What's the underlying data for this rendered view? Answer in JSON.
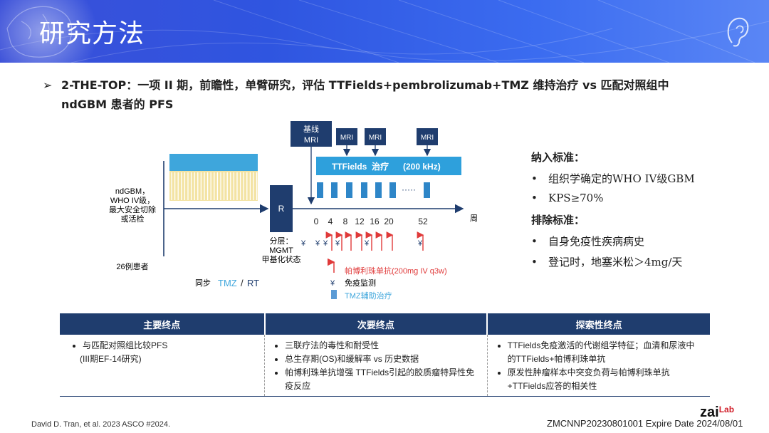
{
  "header": {
    "title": "研究方法"
  },
  "bullet": {
    "arrow": "➢",
    "line1": "2-THE-TOP：一项 II 期，前瞻性，单臂研究，评估 TTFields+pembrolizumab+TMZ 维持治疗 vs 匹配对照组中",
    "line2": "ndGBM 患者的 PFS"
  },
  "schema": {
    "patient_label": [
      "ndGBM，",
      "WHO IV级，",
      "最大安全切除",
      "或活检"
    ],
    "patient_count": "26例患者",
    "sync_label": "同步",
    "sync_tmz": "TMZ",
    "sync_sep": "/",
    "sync_rt": "RT",
    "r_label": "R",
    "strat": [
      "分层：",
      "MGMT",
      "甲基化状态"
    ],
    "baseline_mri": [
      "基线",
      "MRI"
    ],
    "mri": "MRI",
    "ttfields_bar": "TTFields  治疗      (200 kHz)",
    "dots": "·····",
    "weeks": [
      "0",
      "4",
      "8",
      "12",
      "16",
      "20",
      "52"
    ],
    "week_unit": "周",
    "yen": "¥",
    "legend_pembro": "帕博利珠单抗(200mg IV q3w)",
    "legend_immune": "免疫监测",
    "legend_tmz": "TMZ辅助治疗"
  },
  "criteria": {
    "inclusion_title": "纳入标准：",
    "inclusion": [
      "组织学确定的WHO IV级GBM",
      "KPS≥70%"
    ],
    "exclusion_title": "排除标准：",
    "exclusion": [
      "自身免疫性疾病病史",
      "登记时，地塞米松＞4mg/天"
    ],
    "bullet": "•"
  },
  "endpoints": {
    "headers": [
      "主要终点",
      "次要终点",
      "探索性终点"
    ],
    "primary": [
      "与匹配对照组比较PFS",
      "(III期EF-14研究)"
    ],
    "secondary": [
      "三联疗法的毒性和耐受性",
      "总生存期(OS)和缓解率 vs 历史数据",
      "帕博利珠单抗增强 TTFields引起的胶质瘤特异性免疫反应"
    ],
    "exploratory": [
      "TTFields免疫激活的代谢组学特征；血清和尿液中的TTFields+帕博利珠单抗",
      "原发性肿瘤样本中突变负荷与帕博利珠单抗+TTFields应答的相关性"
    ]
  },
  "footer": {
    "citation": "David D. Tran, et al. 2023 ASCO #2024.",
    "code": "ZMCNNP20230801001 Expire Date 2024/08/01",
    "logo_a": "zai",
    "logo_b": "Lab"
  },
  "colors": {
    "header_blue": "#2f55e0",
    "navy": "#1f3d6e",
    "tt_blue": "#2ea0dc",
    "arrow_red": "#e03a3a",
    "yellow": "#f3e3a3"
  }
}
